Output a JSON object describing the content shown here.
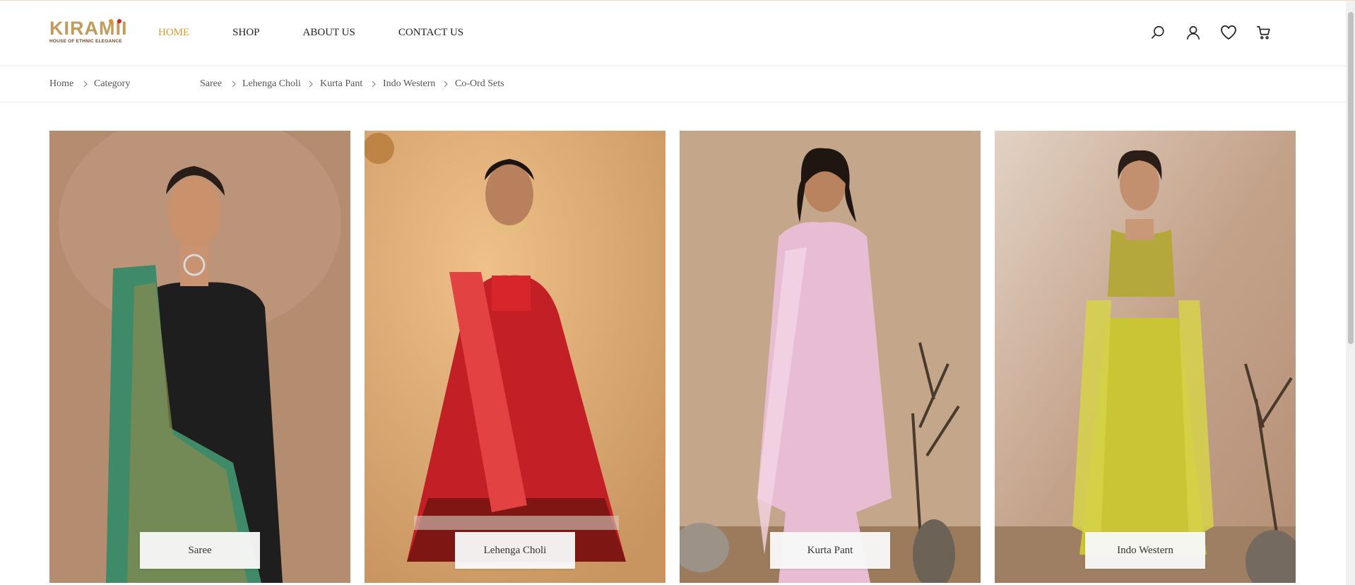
{
  "brand": {
    "name": "KIRAMII",
    "tagline": "HOUSE OF ETHNIC ELEGANCE",
    "color": "#c49a5b"
  },
  "nav": {
    "items": [
      {
        "label": "HOME",
        "active": true
      },
      {
        "label": "SHOP",
        "active": false
      },
      {
        "label": "ABOUT US",
        "active": false
      },
      {
        "label": "CONTACT US",
        "active": false
      }
    ],
    "active_color": "#e09a2c"
  },
  "header_icons": [
    "search-icon",
    "user-icon",
    "heart-icon",
    "cart-icon"
  ],
  "breadcrumb": {
    "home": "Home",
    "category": "Category",
    "links": [
      "Saree",
      "Lehenga Choli",
      "Kurta Pant",
      "Indo Western",
      "Co-Ord Sets"
    ]
  },
  "categories": [
    {
      "label": "Saree",
      "bg": "#b48c70",
      "garment": "#2e8f6e"
    },
    {
      "label": "Lehenga Choli",
      "bg": "#d9a873",
      "garment": "#c8232a"
    },
    {
      "label": "Kurta Pant",
      "bg": "#c4a68b",
      "garment": "#e6bcd3"
    },
    {
      "label": "Indo Western",
      "bg": "#c4a28a",
      "garment": "#c7c73a"
    }
  ]
}
